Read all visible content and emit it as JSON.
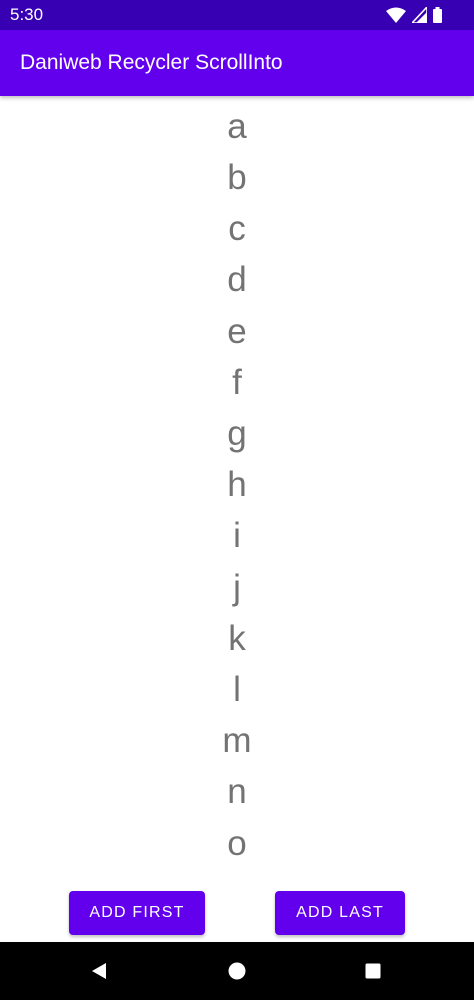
{
  "status_bar": {
    "time": "5:30",
    "icons": [
      "wifi-icon",
      "signal-icon",
      "battery-icon"
    ],
    "color": "#3700b3"
  },
  "app_bar": {
    "title": "Daniweb Recycler ScrollInto",
    "color": "#6200ee"
  },
  "list": {
    "items": [
      "a",
      "b",
      "c",
      "d",
      "e",
      "f",
      "g",
      "h",
      "i",
      "j",
      "k",
      "l",
      "m",
      "n",
      "o"
    ],
    "text_color": "#737373"
  },
  "buttons": {
    "add_first": "ADD FIRST",
    "add_last": "ADD LAST",
    "color": "#6200ee"
  },
  "nav_bar": {
    "icons": [
      "back-icon",
      "home-icon",
      "recents-icon"
    ]
  }
}
